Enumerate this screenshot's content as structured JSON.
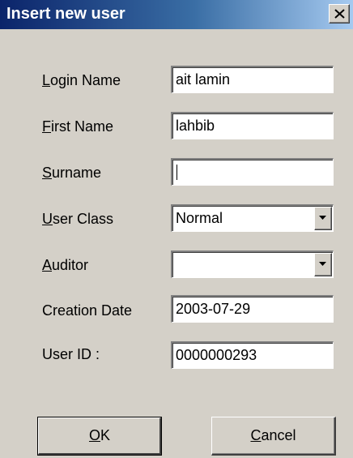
{
  "window": {
    "title": "Insert new user",
    "close_glyph": "×"
  },
  "fields": {
    "login_name": {
      "label_mnemonic": "L",
      "label_rest": "ogin Name",
      "value": "ait lamin"
    },
    "first_name": {
      "label_mnemonic": "F",
      "label_rest": "irst Name",
      "value": "lahbib"
    },
    "surname": {
      "label_mnemonic": "S",
      "label_rest": "urname",
      "value": ""
    },
    "user_class": {
      "label_mnemonic": "U",
      "label_rest": "ser Class",
      "value": "Normal"
    },
    "auditor": {
      "label_mnemonic": "A",
      "label_rest": "uditor",
      "value": ""
    },
    "creation_date": {
      "label": "Creation Date",
      "value": "2003-07-29"
    },
    "user_id": {
      "label": "User ID :",
      "value": "0000000293"
    }
  },
  "buttons": {
    "ok": {
      "mnemonic": "O",
      "rest": "K"
    },
    "cancel": {
      "mnemonic": "C",
      "rest": "ancel"
    }
  },
  "icons": {
    "close": "close-icon",
    "dropdown": "chevron-down-icon"
  },
  "colors": {
    "face": "#d4d0c8",
    "title_start": "#0b246a",
    "title_end": "#a6caf0",
    "field_bg": "#ffffff"
  }
}
